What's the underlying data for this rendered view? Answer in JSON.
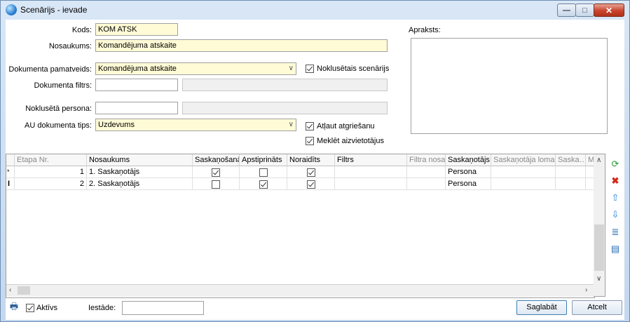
{
  "window": {
    "title": "Scenārijs - ievade",
    "min_glyph": "—",
    "max_glyph": "□",
    "close_glyph": "✕"
  },
  "form": {
    "kods_label": "Kods:",
    "kods_value": "KOM ATSK",
    "nosaukums_label": "Nosaukums:",
    "nosaukums_value": "Komandējuma atskaite",
    "pamatveids_label": "Dokumenta pamatveids:",
    "pamatveids_value": "Komandējuma atskaite",
    "noklusetais_label": "Noklusētais scenārijs",
    "filtrs_label": "Dokumenta filtrs:",
    "persona_label": "Noklusētā persona:",
    "au_tips_label": "AU dokumenta tips:",
    "au_tips_value": "Uzdevums",
    "atlaut_label": "Atļaut atgriešanu",
    "meklet_label": "Meklēt aizvietotājus",
    "apraksts_label": "Apraksts:"
  },
  "grid": {
    "columns": [
      "Etapa Nr.",
      "Nosaukums",
      "Saskaņošanā",
      "Apstiprināts",
      "Noraidīts",
      "Filtrs",
      "Filtra nosa",
      "Saskaņotājs",
      "Saskaņotāja loma",
      "Saska…",
      "M"
    ],
    "rows": [
      {
        "indicator": "*",
        "nr": "1",
        "name": "1. Saskaņotājs",
        "saskanosana": true,
        "apstiprinats": false,
        "noraidits": true,
        "filtrs": "",
        "filtra_nos": "",
        "saskanotajs": "Persona"
      },
      {
        "indicator": "I",
        "nr": "2",
        "name": "2. Saskaņotājs",
        "saskanosana": false,
        "apstiprinats": true,
        "noraidits": true,
        "filtrs": "",
        "filtra_nos": "",
        "saskanotajs": "Persona"
      }
    ]
  },
  "footer": {
    "aktivs_label": "Aktīvs",
    "iestade_label": "Iestāde:",
    "iestade_value": "",
    "save_label": "Saglabāt",
    "cancel_label": "Atcelt"
  },
  "colors": {
    "required_bg": "#fffbd6",
    "close_red": "#c9452e",
    "accent_blue": "#2a7fd4"
  }
}
